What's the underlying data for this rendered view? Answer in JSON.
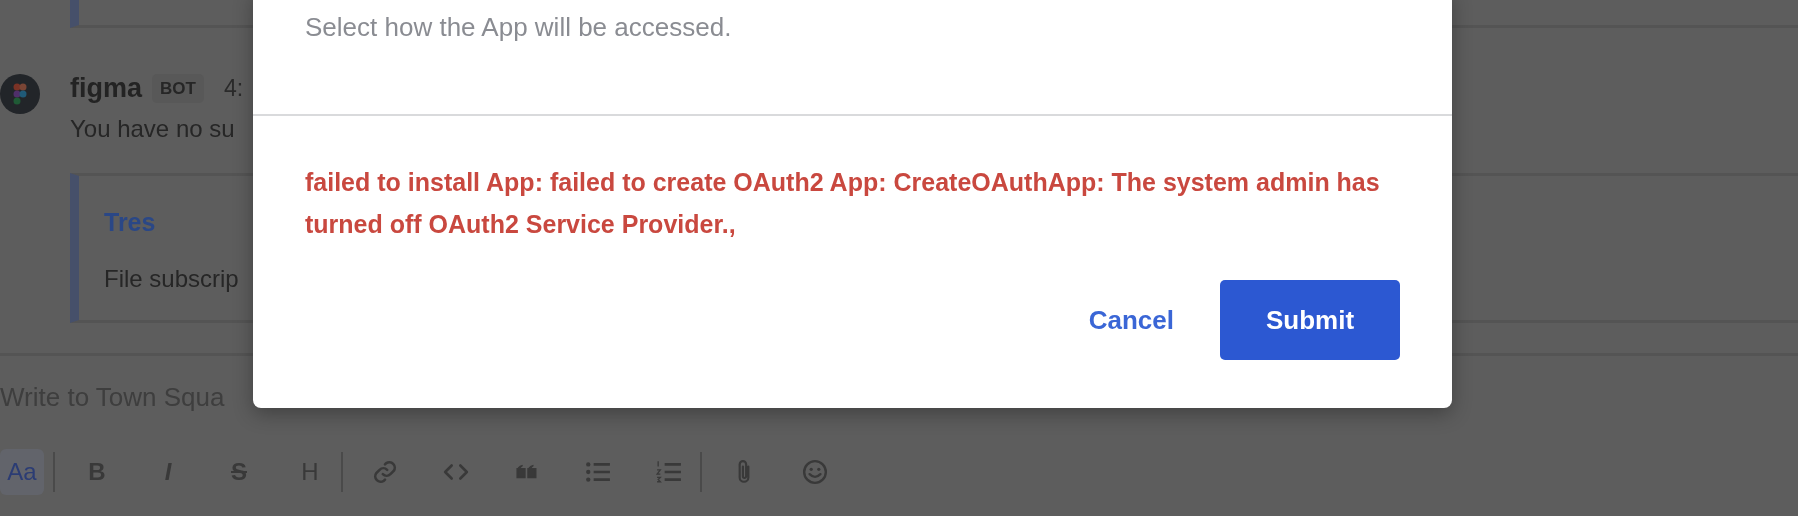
{
  "channel": {
    "messages": [
      {
        "author": "figma",
        "badge": "BOT",
        "time": "4:",
        "text": "You have no su",
        "attachment": {
          "title": "Tres",
          "text": "File subscrip"
        }
      }
    ],
    "composer": {
      "placeholder": "Write to Town Squa"
    },
    "toolbar": [
      {
        "kind": "plain",
        "label": "Aa",
        "selected": true
      },
      {
        "kind": "divider"
      },
      {
        "kind": "bold",
        "label": "B",
        "selected": false
      },
      {
        "kind": "italic",
        "label": "I",
        "selected": false
      },
      {
        "kind": "strike",
        "label": "S",
        "selected": false
      },
      {
        "kind": "plain",
        "label": "H",
        "selected": false
      },
      {
        "kind": "divider"
      },
      {
        "kind": "link",
        "selected": false
      },
      {
        "kind": "code",
        "selected": false
      },
      {
        "kind": "quote",
        "selected": false
      },
      {
        "kind": "bullets",
        "selected": false
      },
      {
        "kind": "numbered",
        "selected": false
      },
      {
        "kind": "divider"
      },
      {
        "kind": "attach",
        "selected": false
      },
      {
        "kind": "emoji",
        "selected": false
      }
    ]
  },
  "dialog": {
    "help_text": "Select how the App will be accessed.",
    "error": "failed to install App: failed to create OAuth2 App: CreateOAuthApp: The system admin has turned off OAuth2 Service Provider.,",
    "buttons": [
      {
        "label": "Cancel",
        "kind": "link"
      },
      {
        "label": "Submit",
        "kind": "primary"
      }
    ]
  }
}
